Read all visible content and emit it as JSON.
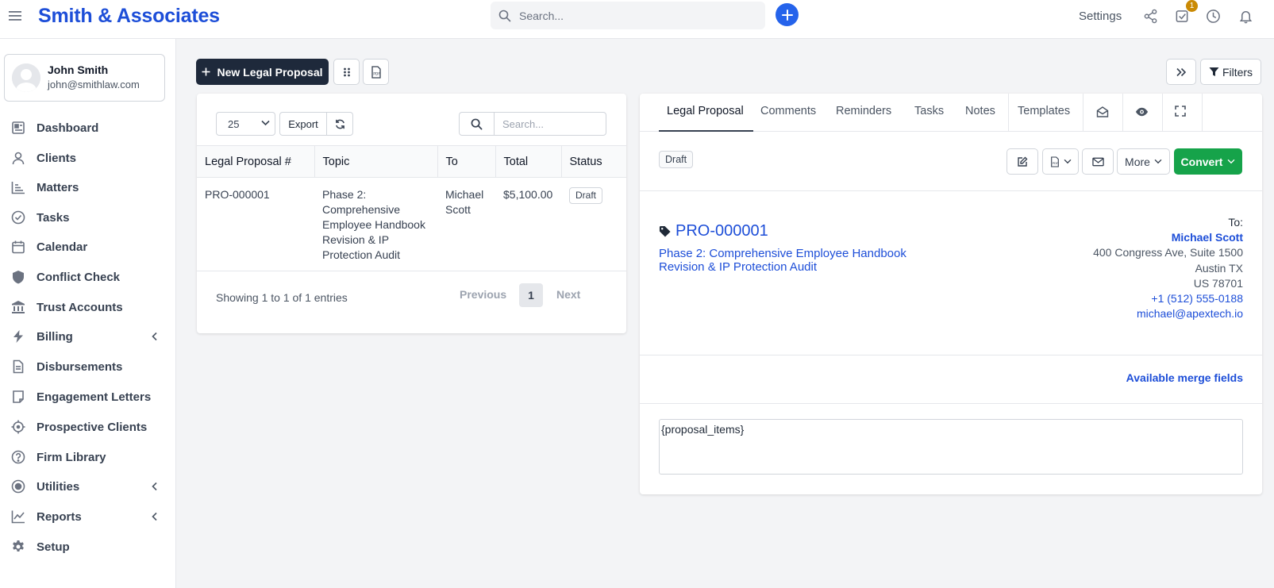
{
  "app": {
    "brand": "Smith & Associates",
    "search_placeholder": "Search...",
    "settings_label": "Settings",
    "notification_count": "1"
  },
  "user": {
    "name": "John Smith",
    "email": "john@smithlaw.com"
  },
  "sidebar": {
    "items": [
      {
        "label": "Dashboard",
        "icon": "dashboard-icon"
      },
      {
        "label": "Clients",
        "icon": "user-icon"
      },
      {
        "label": "Matters",
        "icon": "matters-icon"
      },
      {
        "label": "Tasks",
        "icon": "check-circle-icon"
      },
      {
        "label": "Calendar",
        "icon": "calendar-icon"
      },
      {
        "label": "Conflict Check",
        "icon": "shield-icon"
      },
      {
        "label": "Trust Accounts",
        "icon": "bank-icon"
      },
      {
        "label": "Billing",
        "icon": "bolt-icon",
        "has_submenu": true
      },
      {
        "label": "Disbursements",
        "icon": "document-icon"
      },
      {
        "label": "Engagement Letters",
        "icon": "letter-icon"
      },
      {
        "label": "Prospective Clients",
        "icon": "crosshair-icon"
      },
      {
        "label": "Firm Library",
        "icon": "question-circle-icon"
      },
      {
        "label": "Utilities",
        "icon": "target-icon",
        "has_submenu": true
      },
      {
        "label": "Reports",
        "icon": "chart-line-icon",
        "has_submenu": true
      },
      {
        "label": "Setup",
        "icon": "gear-icon"
      }
    ]
  },
  "toolbar": {
    "new_label": "New Legal Proposal",
    "filters_label": "Filters"
  },
  "table": {
    "page_length": "25",
    "export_label": "Export",
    "search_placeholder": "Search...",
    "columns": [
      "Legal Proposal #",
      "Topic",
      "To",
      "Total",
      "Status"
    ],
    "rows": [
      {
        "number": "PRO-000001",
        "topic": "Phase 2: Comprehensive Employee Handbook Revision & IP Protection Audit",
        "to": "Michael Scott",
        "total": "$5,100.00",
        "status": "Draft"
      }
    ],
    "info": "Showing 1 to 1 of 1 entries",
    "prev_label": "Previous",
    "current_page": "1",
    "next_label": "Next"
  },
  "detail": {
    "tabs": [
      "Legal Proposal",
      "Comments",
      "Reminders",
      "Tasks",
      "Notes",
      "Templates"
    ],
    "active_tab": "Legal Proposal",
    "status": "Draft",
    "more_label": "More",
    "convert_label": "Convert",
    "proposal_number": "PRO-000001",
    "topic": "Phase 2: Comprehensive Employee Handbook Revision & IP Protection Audit",
    "to_label": "To:",
    "to_name": "Michael Scott",
    "address_line1": "400 Congress Ave, Suite 1500",
    "address_line2": "Austin TX",
    "address_line3": "US 78701",
    "phone": "+1 (512) 555-0188",
    "email": "michael@apextech.io",
    "merge_fields_label": "Available merge fields",
    "items_placeholder": "{proposal_items}"
  },
  "colors": {
    "brand": "#1d4ed8",
    "primary_button": "#1e293b",
    "convert": "#16a34a",
    "badge": "#ca8a04"
  }
}
